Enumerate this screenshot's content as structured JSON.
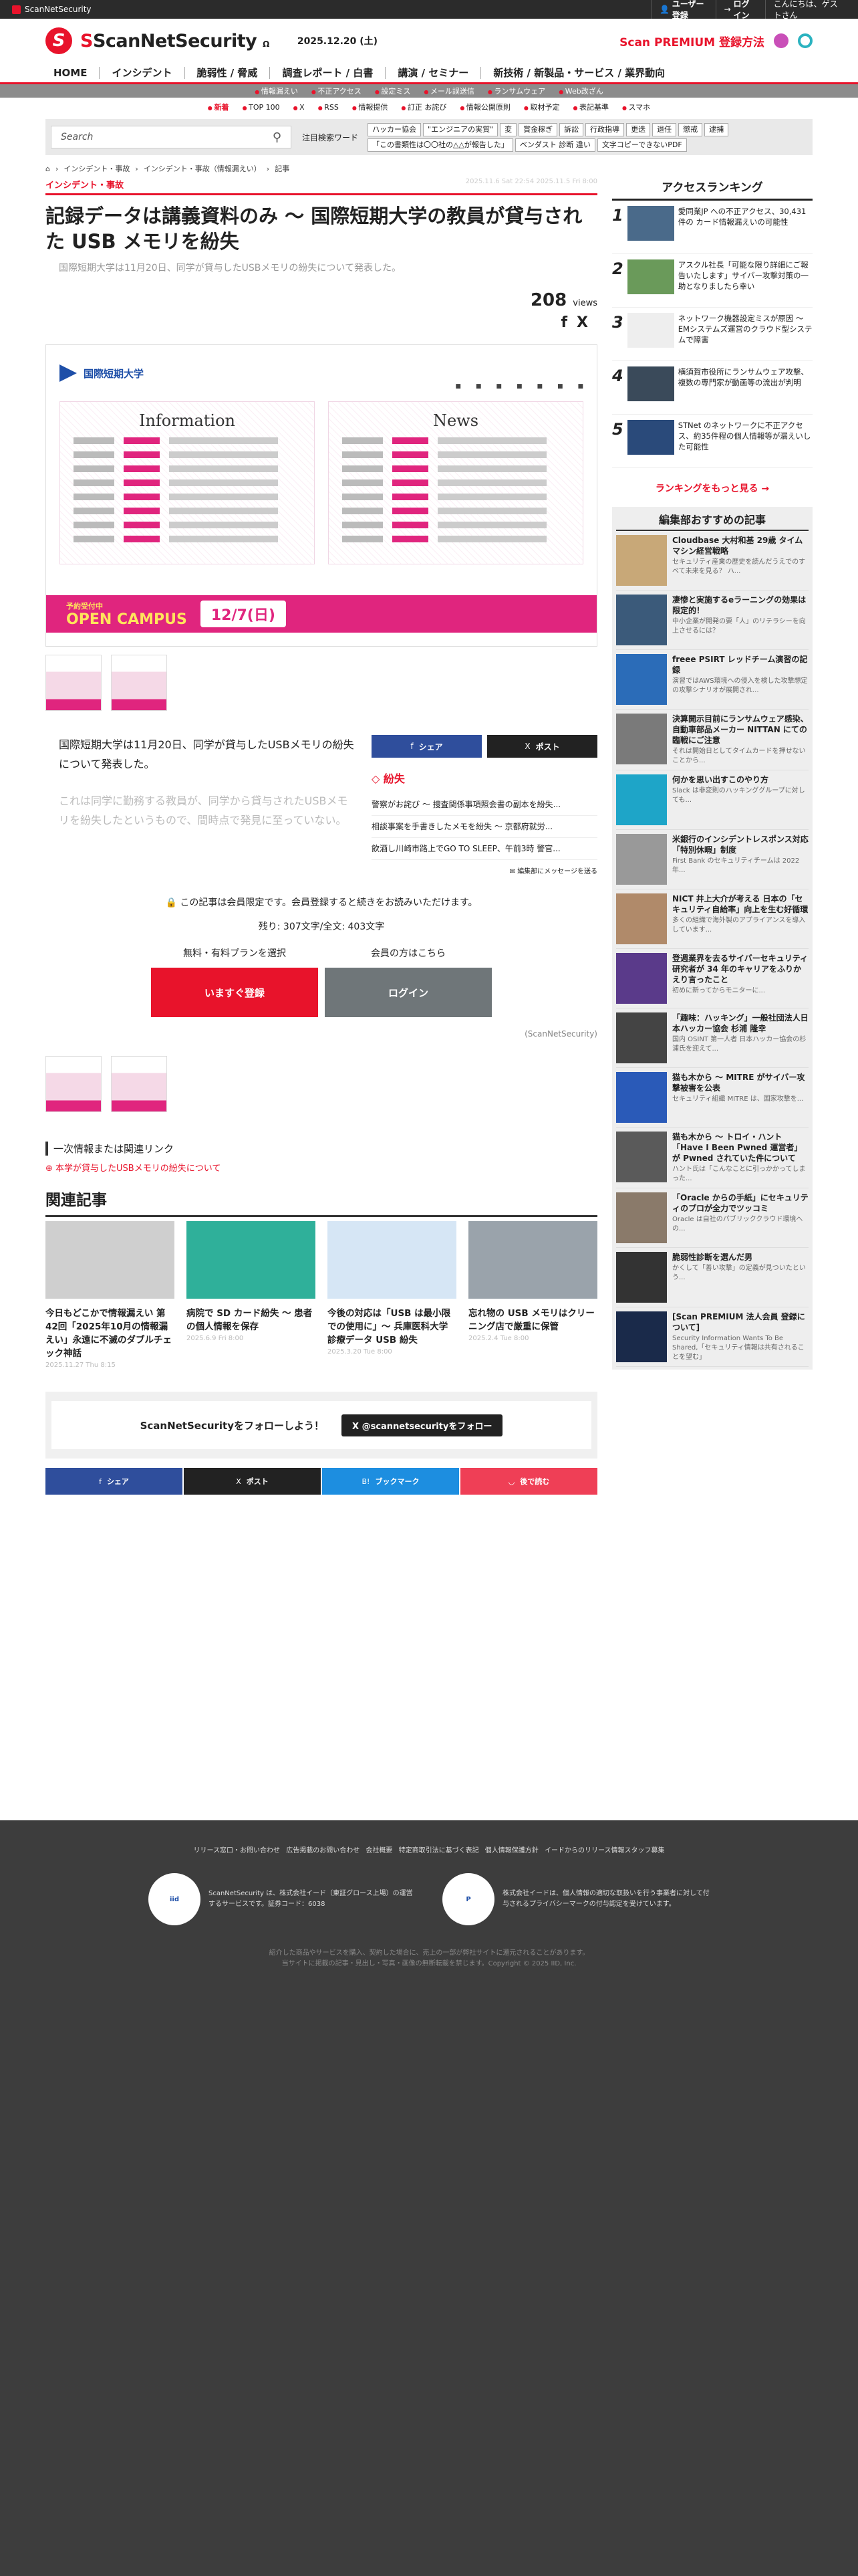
{
  "topbar": {
    "site": "ScanNetSecurity",
    "register": "ユーザー登録",
    "login": "ログイン",
    "greeting": "こんにちは、ゲストさん"
  },
  "header": {
    "logo_main": "ScanNetSecurity",
    "logo_sub": "Ω",
    "date": "2025.12.20 (土)",
    "premium": "Scan PREMIUM 登録方法"
  },
  "nav": [
    "HOME",
    "インシデント",
    "脆弱性 / 脅威",
    "調査レポート / 白書",
    "講演 / セミナー",
    "新技術 / 新製品・サービス / 業界動向"
  ],
  "tags1": [
    "情報漏えい",
    "不正アクセス",
    "設定ミス",
    "メール誤送信",
    "ランサムウェア",
    "Web改ざん"
  ],
  "tags2": [
    "新着",
    "TOP 100",
    "X",
    "RSS",
    "情報提供",
    "訂正 お詫び",
    "情報公開原則",
    "取材予定",
    "表記基準",
    "スマホ"
  ],
  "search": {
    "placeholder": "Search",
    "label": "注目検索ワード",
    "keywords": [
      "ハッカー協会",
      "\"エンジニアの実質\"",
      "変",
      "賞金稼ぎ",
      "訴訟",
      "行政指導",
      "更迭",
      "退任",
      "懲戒",
      "逮捕",
      "「この書類性は〇〇社の△△が報告した」",
      "ベンダスト 診断 違い",
      "文字コピーできないPDF"
    ]
  },
  "breadcrumb": [
    "インシデント・事故",
    "インシデント・事故（情報漏えい）",
    "記事"
  ],
  "article": {
    "category": "インシデント・事故",
    "dates": "2025.11.6 Sat 22:54 2025.11.5 Fri 8:00",
    "title": "記録データは講義資料のみ 〜 国際短期大学の教員が貸与された USB メモリを紛失",
    "lead": "国際短期大学は11月20日、同学が貸与したUSBメモリの紛失について発表した。",
    "views_count": "208",
    "views_label": "views",
    "p1": "国際短期大学は11月20日、同学が貸与したUSBメモリの紛失について発表した。",
    "p2": "これは同学に勤務する教員が、同学から貸与されたUSBメモリを紛失したというもので、間時点で発見に至っていない。",
    "locked": "この記事は会員限定です。会員登録すると続きをお読みいただけます。",
    "remaining": "残り: 307文字/全文: 403文字",
    "plan_free": "無料・有料プランを選択",
    "plan_member": "会員の方はこちら",
    "btn_register": "いますぐ登録",
    "btn_login": "ログイン",
    "source": "(ScanNetSecurity)",
    "primary_heading": "一次情報または関連リンク",
    "primary_link": "本学が貸与したUSBメモリの紛失について"
  },
  "hero": {
    "institution": "国際短期大学",
    "info": "Information",
    "news": "News",
    "open_campus": "OPEN CAMPUS",
    "oc_label": "予約受付中",
    "oc_date": "12/7(日)"
  },
  "share": {
    "facebook": "シェア",
    "x": "ポスト",
    "hatena": "ブックマーク",
    "pocket": "後で読む"
  },
  "related_side": {
    "heading": "紛失",
    "items": [
      "警察がお詫び 〜 捜査関係事項照会書の副本を紛失...",
      "相談事案を手書きしたメモを紛失 〜 京都府就労...",
      "飲酒し川崎市路上でGO TO SLEEP、午前3時 警官..."
    ],
    "message": "編集部にメッセージを送る"
  },
  "kanren": {
    "heading": "関連記事",
    "cards": [
      {
        "title": "今日もどこかで情報漏えい 第42回「2025年10月の情報漏えい」永遠に不滅のダブルチェック神話",
        "date": "2025.11.27 Thu 8:15"
      },
      {
        "title": "病院で SD カード紛失 〜 患者の個人情報を保存",
        "date": "2025.6.9 Fri 8:00"
      },
      {
        "title": "今後の対応は「USB は最小限での使用に」〜 兵庫医科大学 診療データ USB 紛失",
        "date": "2025.3.20 Tue 8:00"
      },
      {
        "title": "忘れ物の USB メモリはクリーニング店で厳重に保管",
        "date": "2025.2.4 Tue 8:00"
      }
    ]
  },
  "follow": {
    "text": "ScanNetSecurityをフォローしよう！",
    "button": "@scannetsecurityをフォロー"
  },
  "sidebar": {
    "ranking_heading": "アクセスランキング",
    "ranking": [
      {
        "n": "1",
        "title": "愛同業JP への不正アクセス、30,431 件の カード情報漏えいの可能性"
      },
      {
        "n": "2",
        "title": "アスクル社長「可能な限り詳細にご報告いたします」サイバー攻撃対策の一助となりましたら幸い"
      },
      {
        "n": "3",
        "title": "ネットワーク機器設定ミスが原因 〜 EMシステムズ運営のクラウド型システムで障害"
      },
      {
        "n": "4",
        "title": "横須賀市役所にランサムウェア攻撃、複数の専門家が動画等の流出が判明"
      },
      {
        "n": "5",
        "title": "STNet のネットワークに不正アクセス、約35件程の個人情報等が漏えいした可能性"
      }
    ],
    "more": "ランキングをもっと見る",
    "rec_heading": "編集部おすすめの記事",
    "rec": [
      {
        "title": "Cloudbase 大村和基 29歳 タイムマシン経営戦略",
        "desc": "セキュリティ産業の歴史を読んだうえでのすべて未来を見る？ ハ..."
      },
      {
        "title": "凄惨と実施するeラーニングの効果は限定的！",
        "desc": "中小企業が開発の要「人」のリテラシーを向上させるには？"
      },
      {
        "title": "freee PSIRT レッドチーム演習の記録",
        "desc": "演習ではAWS環境への侵入を検した攻撃想定の攻撃シナリオが展開され..."
      },
      {
        "title": "決算開示目前にランサムウェア感染、自動車部品メーカー NITTAN にての臨戦にご注意",
        "desc": "それは開始日としてタイムカードを押せないことから..."
      },
      {
        "title": "何かを思い出すこのやり方",
        "desc": "Slack は非変則のハッキンググループに対しても..."
      },
      {
        "title": "米銀行のインシデントレスポンス対応「特別休暇」制度",
        "desc": "First Bank のセキュリティチームは 2022 年..."
      },
      {
        "title": "NICT 井上大介が考える 日本の「セキュリティ自給率」向上を生む好循環",
        "desc": "多くの組織で海外製のアプライアンスを導入しています..."
      },
      {
        "title": "登週業界を去るサイバーセキュリティ研究者が 34 年のキャリアをふりかえり言ったこと",
        "desc": "初めに新ってからモニターに..."
      },
      {
        "title": "「趣味：ハッキング」一般社団法人日本ハッカー協会 杉浦 隆幸",
        "desc": "国内 OSINT 第一人者 日本ハッカー協会の杉浦氏を迎えて..."
      },
      {
        "title": "猫も木から 〜 MITRE がサイバー攻撃被害を公表",
        "desc": "セキュリティ組織 MITRE は、国家攻撃を..."
      },
      {
        "title": "猫も木から 〜 トロイ・ハント「Have I Been Pwned 運営者」が Pwned されていた件について",
        "desc": "ハント氏は「こんなことに引っかかってしまった..."
      },
      {
        "title": "「Oracle からの手紙」にセキュリティのプロが全力でツッコミ",
        "desc": "Oracle は自社のパブリッククラウド環境への..."
      },
      {
        "title": "脆弱性診断を選んだ男",
        "desc": "かくして「善い攻撃」の定義が見ついたという..."
      },
      {
        "title": "[Scan PREMIUM 法人会員 登録について]",
        "desc": "Security Information Wants To Be Shared,「セキュリティ情報は共有されることを望む」"
      }
    ]
  },
  "footer": {
    "links": "リリース窓口・お問い合わせ 広告掲載のお問い合わせ 会社概要 特定商取引法に基づく表記 個人情報保護方針 イードからのリリース情報スタッフ募集",
    "co1": "ScanNetSecurity は、株式会社イード（東証グロース上場）の運営するサービスです。証券コード：6038",
    "co2": "株式会社イードは、個人情報の適切な取扱いを行う事業者に対して付与されるプライバシーマークの付与認定を受けています。",
    "note": "紹介した商品やサービスを購入、契約した場合に、売上の一部が弊社サイトに還元されることがあります。",
    "copyright": "当サイトに掲載の記事・見出し・写真・画像の無断転載を禁じます。Copyright © 2025 IID, Inc."
  },
  "colors": {
    "brand": "#e8132b",
    "pink": "#e0257e"
  }
}
